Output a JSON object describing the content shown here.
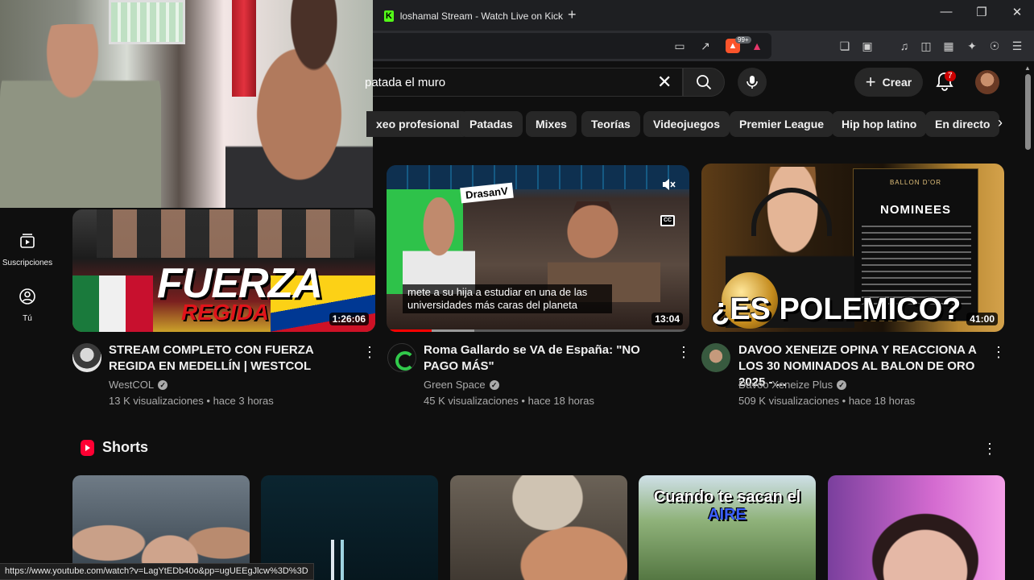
{
  "browser": {
    "tab_title": "loshamal Stream - Watch Live on Kick",
    "tab_favicon": "kick-icon",
    "new_tab": "+",
    "brave_badge": "99+",
    "status_url": "https://www.youtube.com/watch?v=LagYtEDb40o&pp=ugUEEgJlcw%3D%3D"
  },
  "youtube": {
    "search": {
      "query": "patada el muro"
    },
    "create_label": "Crear",
    "notification_count": "7",
    "chips": [
      "Boxeo profesional",
      "Patadas",
      "Mixes",
      "Teorías",
      "Videojuegos",
      "Premier League",
      "Hip hop latino",
      "En directo"
    ],
    "chips_visible": [
      "xeo profesional",
      "Patadas",
      "Mixes",
      "Teorías",
      "Videojuegos",
      "Premier League",
      "Hip hop latino",
      "En directo"
    ],
    "rail": [
      {
        "label": "Suscripciones",
        "icon": "subscriptions-icon"
      },
      {
        "label": "Tú",
        "icon": "you-icon"
      }
    ],
    "videos": [
      {
        "title": "STREAM COMPLETO CON FUERZA REGIDA EN MEDELLÍN | WESTCOL",
        "channel": "WestCOL",
        "views": "13 K visualizaciones",
        "age": "hace 3 horas",
        "duration": "1:26:06",
        "thumb_text_1": "FUERZA",
        "thumb_text_2": "REGIDA"
      },
      {
        "title": "Roma Gallardo se VA de España: \"NO PAGO MÁS\"",
        "channel": "Green Space",
        "views": "45 K visualizaciones",
        "age": "hace 18 horas",
        "duration": "13:04",
        "thumb_tag": "DrasanV",
        "caption": "mete a su hija a estudiar en una de las universidades más caras del planeta",
        "progress": 0.15,
        "buffered": 0.29
      },
      {
        "title": "DAVOO XENEIZE OPINA Y REACCIONA A LOS 30 NOMINADOS AL BALON DE ORO 2025 - ...",
        "channel": "Davoo Xeneize Plus",
        "views": "509 K visualizaciones",
        "age": "hace 18 horas",
        "duration": "41:00",
        "thumb_ballon": "BALLON D'OR",
        "thumb_board": "NOMINEES",
        "thumb_text": "¿ES POLEMICO?"
      }
    ],
    "shorts": {
      "title": "Shorts",
      "items": [
        {
          "overlay_1": ""
        },
        {
          "overlay_1": ""
        },
        {
          "overlay_1": ""
        },
        {
          "overlay_1": "Cuando te sacan el",
          "overlay_2": "AIRE"
        },
        {
          "overlay_1": ""
        }
      ]
    }
  },
  "colors": {
    "kick_green": "#53fc18",
    "yt_red": "#ff0000",
    "background": "#0f0f0f"
  }
}
